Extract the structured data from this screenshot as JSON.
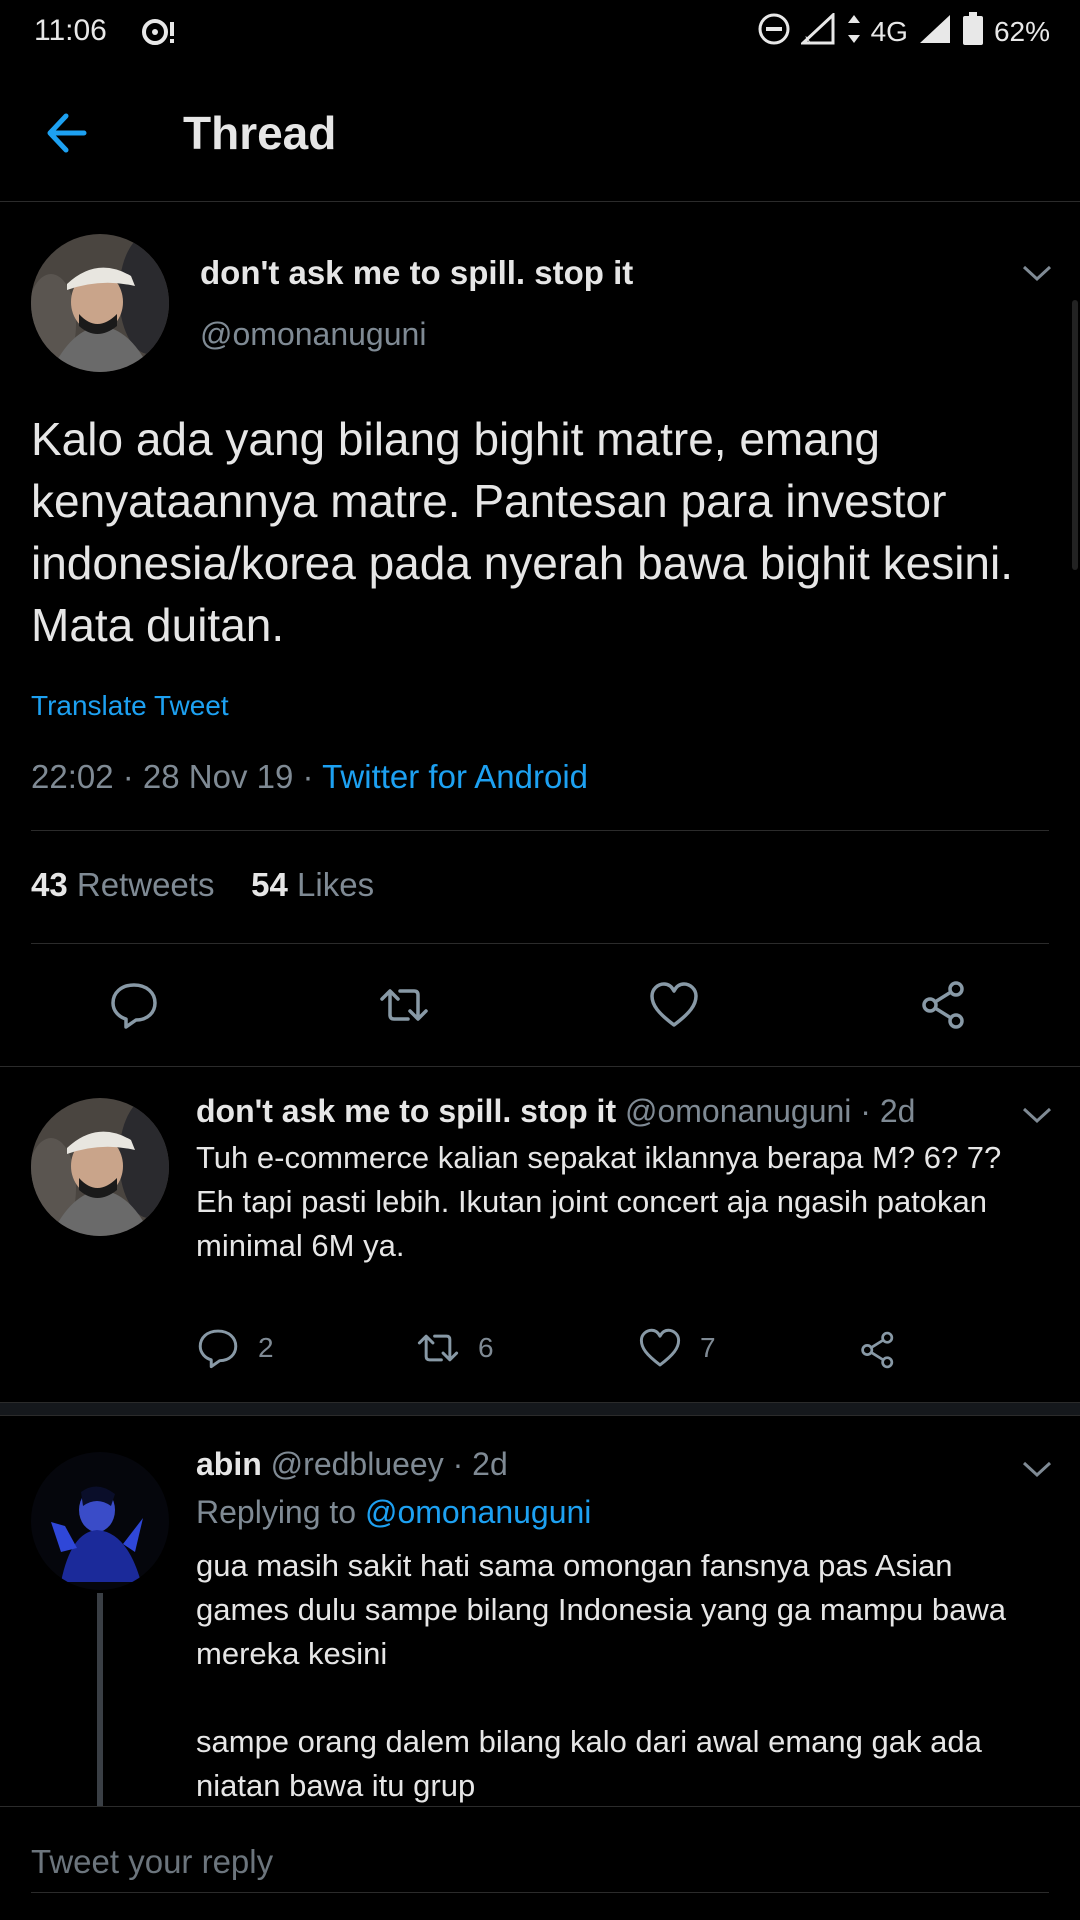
{
  "status": {
    "time": "11:06",
    "network": "4G",
    "battery": "62%"
  },
  "header": {
    "title": "Thread",
    "back_icon": "arrow-left-icon",
    "accent": "#1da1f2"
  },
  "main_tweet": {
    "name": "don't ask me to spill. stop it",
    "handle": "@omonanuguni",
    "text": "Kalo ada yang bilang bighit matre, emang kenyataannya matre. Pantesan para investor indonesia/korea pada nyerah bawa bighit kesini. Mata duitan.",
    "translate": "Translate Tweet",
    "timestamp": "22:02 · 28 Nov 19 · ",
    "source": "Twitter for Android",
    "retweets_count": "43",
    "retweets_label": "Retweets",
    "likes_count": "54",
    "likes_label": "Likes"
  },
  "replies": [
    {
      "name": "don't ask me to spill. stop it",
      "handle": "@omonanuguni",
      "age": "· 2d",
      "text": "Tuh e-commerce kalian sepakat iklannya berapa M? 6? 7? Eh tapi pasti lebih. Ikutan joint concert aja ngasih patokan minimal 6M ya.",
      "replies": "2",
      "retweets": "6",
      "likes": "7"
    },
    {
      "name": "abin",
      "handle": "@redblueey",
      "age": "· 2d",
      "replying_prefix": "Replying to ",
      "replying_to": "@omonanuguni",
      "text_p1": "gua masih sakit hati sama omongan fansnya pas Asian games dulu sampe bilang Indonesia yang ga mampu bawa mereka kesini",
      "text_p2": "sampe orang dalem bilang kalo dari awal emang gak ada niatan bawa itu grup"
    }
  ],
  "compose": {
    "placeholder": "Tweet your reply"
  }
}
